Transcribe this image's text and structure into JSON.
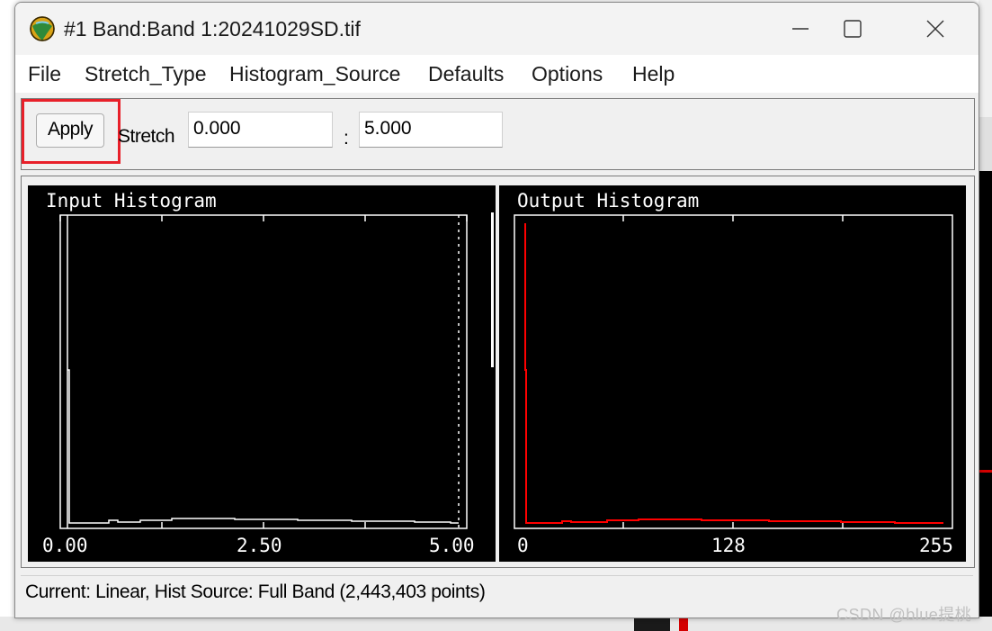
{
  "window": {
    "title": "#1 Band:Band 1:20241029SD.tif",
    "icon": "envi-globe-icon"
  },
  "menu": [
    "File",
    "Stretch_Type",
    "Histogram_Source",
    "Defaults",
    "Options",
    "Help"
  ],
  "toolbar": {
    "apply_label": "Apply",
    "stretch_label": "Stretch",
    "stretch_min": "0.000",
    "separator": ":",
    "stretch_max": "5.000",
    "highlight_color": "#e8202a"
  },
  "input_histogram": {
    "title": "Input Histogram",
    "tick_labels": [
      "0.00",
      "2.50",
      "5.00"
    ],
    "line_color": "#ffffff"
  },
  "output_histogram": {
    "title": "Output Histogram",
    "tick_labels": [
      "0",
      "128",
      "255"
    ],
    "line_color": "#ff0000"
  },
  "status": "Current: Linear, Hist Source: Full Band (2,443,403 points)",
  "watermark": "CSDN @blue提桃"
}
